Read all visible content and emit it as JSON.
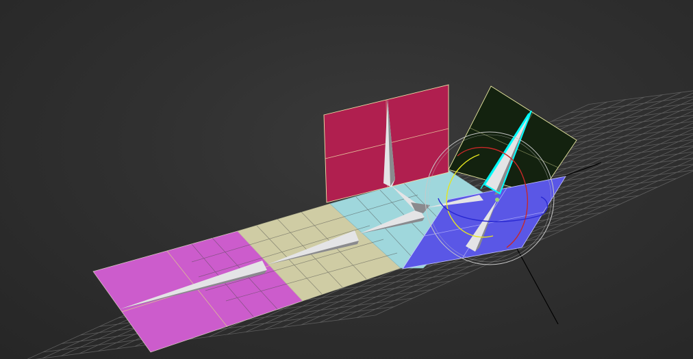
{
  "viewport": {
    "background_color": "#2b2b2b",
    "grid_color": "#5f5f5f",
    "axis_color": "#000000"
  },
  "colors": {
    "panel_magenta": "#cc5ccc",
    "panel_tan": "#cfcca4",
    "panel_cyan": "#9fd7dc",
    "panel_crimson": "#b01f4f",
    "panel_dark_green": "#13220f",
    "panel_blue": "#5a57e6",
    "bone_light": "#e4e4e6",
    "bone_dark": "#8a8a8e",
    "selection_cyan": "#00ffff",
    "rotate_gizmo_x": "#c82828",
    "rotate_gizmo_y": "#e6e61e",
    "rotate_gizmo_z": "#2828d2",
    "rotate_gizmo_outer": "#c8c8c8"
  },
  "objects": [
    {
      "name": "magenta-plane-object",
      "type": "plane",
      "color": "magenta"
    },
    {
      "name": "tan-plane-object",
      "type": "plane",
      "color": "tan"
    },
    {
      "name": "cyan-plane-object",
      "type": "plane",
      "color": "cyan"
    },
    {
      "name": "crimson-plane-object",
      "type": "plane",
      "color": "crimson"
    },
    {
      "name": "dark-green-plane-object",
      "type": "plane",
      "color": "dark-green",
      "selected": true
    },
    {
      "name": "blue-plane-object",
      "type": "plane",
      "color": "blue"
    },
    {
      "name": "bone-chain",
      "type": "bones",
      "count": 5
    }
  ],
  "gizmo": {
    "mode": "rotate",
    "icon": "rotate-gizmo-icon"
  }
}
